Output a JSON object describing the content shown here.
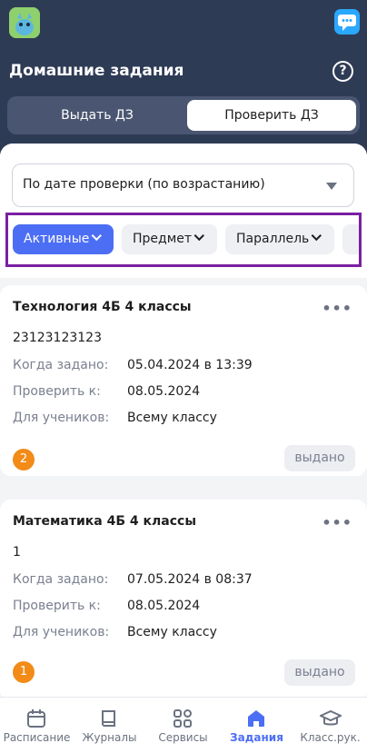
{
  "header": {
    "title": "Домашние задания",
    "app_icon": "app-logo-icon",
    "chat_icon": "chat-icon",
    "help_icon": "help-icon",
    "help_glyph": "?"
  },
  "segmented": {
    "tabs": [
      "Выдать ДЗ",
      "Проверить ДЗ"
    ],
    "active": "Проверить ДЗ"
  },
  "sort": {
    "value": "По дате проверки (по возрастанию)"
  },
  "filters": [
    {
      "label": "Активные"
    },
    {
      "label": "Предмет"
    },
    {
      "label": "Параллель"
    },
    {
      "label": ""
    }
  ],
  "cards": [
    {
      "title": "Технология 4Б 4 классы",
      "description": "23123123123",
      "rows": [
        {
          "label": "Когда задано:",
          "value": "05.04.2024 в 13:39"
        },
        {
          "label": "Проверить к:",
          "value": "08.05.2024"
        },
        {
          "label": "Для учеников:",
          "value": "Всему классу"
        }
      ],
      "count": "2",
      "status": "выдано",
      "more": "•••"
    },
    {
      "title": "Математика 4Б 4 классы",
      "description": "1",
      "rows": [
        {
          "label": "Когда задано:",
          "value": "07.05.2024 в 08:37"
        },
        {
          "label": "Проверить к:",
          "value": "08.05.2024"
        },
        {
          "label": "Для учеников:",
          "value": "Всему классу"
        }
      ],
      "count": "1",
      "status": "выдано",
      "more": "•••"
    }
  ],
  "tabbar": {
    "items": [
      {
        "label": "Расписание",
        "icon": "calendar-icon"
      },
      {
        "label": "Журналы",
        "icon": "book-icon"
      },
      {
        "label": "Сервисы",
        "icon": "grid-icon"
      },
      {
        "label": "Задания",
        "icon": "home-icon"
      },
      {
        "label": "Класс.рук.",
        "icon": "graduation-cap-icon"
      }
    ],
    "active": "Задания"
  },
  "colors": {
    "header_bg": "#2e3b55",
    "accent": "#4c6ef5",
    "badge": "#f28b17",
    "highlight_frame": "#7a1fa2"
  }
}
